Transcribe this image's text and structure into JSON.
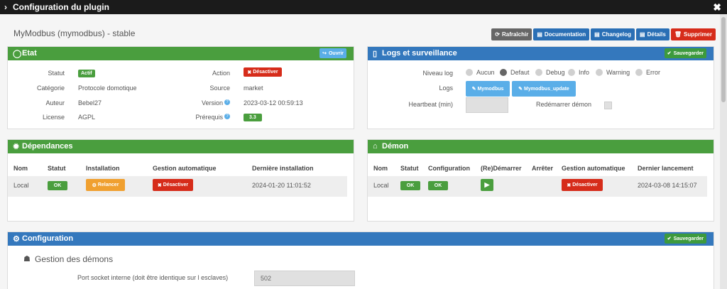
{
  "window": {
    "title": "Configuration du plugin",
    "close": "✖"
  },
  "plugin": {
    "title": "MyModbus (mymodbus) - stable"
  },
  "toolbar": {
    "refresh": "Rafraîchir",
    "documentation": "Documentation",
    "changelog": "Changelog",
    "details": "Détails",
    "delete": "Supprimer"
  },
  "etat": {
    "header": "Etat",
    "open_button": "Ouvrir",
    "statut_label": "Statut",
    "statut_value": "Actif",
    "categorie_label": "Catégorie",
    "categorie_value": "Protocole domotique",
    "auteur_label": "Auteur",
    "auteur_value": "Bebel27",
    "license_label": "License",
    "license_value": "AGPL",
    "action_label": "Action",
    "action_button": "Désactiver",
    "source_label": "Source",
    "source_value": "market",
    "version_label": "Version",
    "version_value": "2023-03-12 00:59:13",
    "prerequis_label": "Prérequis",
    "prerequis_value": "3.3"
  },
  "logs": {
    "header": "Logs et surveillance",
    "save_button": "Sauvegarder",
    "niveau_label": "Niveau log",
    "levels": [
      "Aucun",
      "Defaut",
      "Debug",
      "Info",
      "Warning",
      "Error"
    ],
    "selected_level": "Defaut",
    "logs_label": "Logs",
    "log_buttons": [
      "Mymodbus",
      "Mymodbus_update"
    ],
    "heartbeat_label": "Heartbeat (min)",
    "heartbeat_value": "",
    "restart_label": "Redémarrer démon"
  },
  "dependances": {
    "header": "Dépendances",
    "columns": [
      "Nom",
      "Statut",
      "Installation",
      "Gestion automatique",
      "Dernière installation"
    ],
    "row": {
      "nom": "Local",
      "statut": "OK",
      "installation": "Relancer",
      "gestion": "Désactiver",
      "derniere": "2024-01-20 11:01:52"
    }
  },
  "demon": {
    "header": "Démon",
    "columns": [
      "Nom",
      "Statut",
      "Configuration",
      "(Re)Démarrer",
      "Arrêter",
      "Gestion automatique",
      "Dernier lancement"
    ],
    "row": {
      "nom": "Local",
      "statut": "OK",
      "configuration": "OK",
      "gestion": "Désactiver",
      "dernier": "2024-03-08 14:15:07"
    }
  },
  "configuration": {
    "header": "Configuration",
    "save_button": "Sauvegarder",
    "section_title": "Gestion des démons",
    "port_label": "Port socket interne (doit être identique sur l esclaves)",
    "port_value": "502"
  },
  "colors": {
    "green": "#4a9e3e",
    "blue": "#3478bd",
    "red": "#d62c1a",
    "orange": "#f0a030",
    "lightblue": "#5aaee8"
  },
  "icons": [
    "refresh-icon",
    "book-icon",
    "document-icon",
    "trash-icon",
    "circle-icon",
    "share-icon",
    "file-icon",
    "check-circle-icon",
    "paperclip-icon",
    "gear-icon",
    "bank-icon",
    "gears-icon",
    "user-secret-icon",
    "play-icon",
    "bicycle-icon",
    "close-icon"
  ]
}
